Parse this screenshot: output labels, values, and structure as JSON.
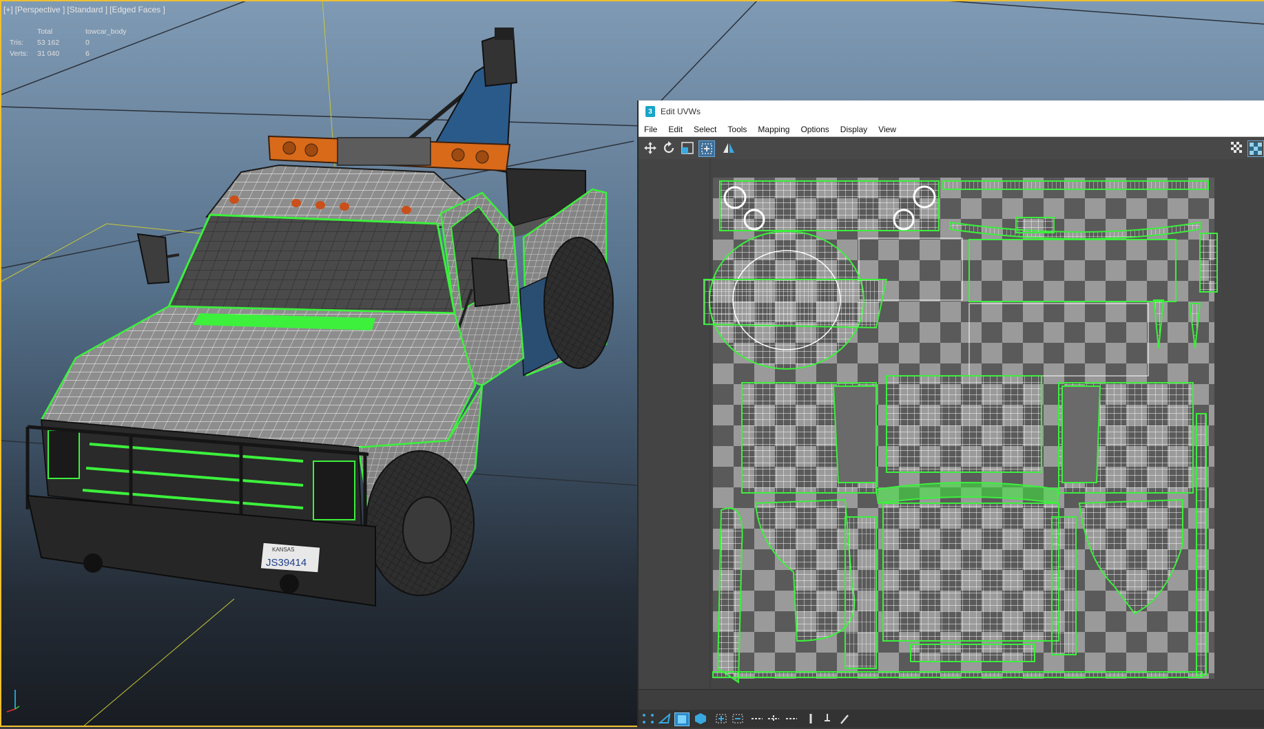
{
  "viewport": {
    "label_parts": [
      "[+]",
      "[Perspective ]",
      "[Standard ]",
      "[Edged Faces ]"
    ],
    "stats": {
      "header_total": "Total",
      "header_object": "towcar_body",
      "rows": [
        {
          "label": "Tris:",
          "total": "53 162",
          "object": "0"
        },
        {
          "label": "Verts:",
          "total": "31 040",
          "object": "6"
        }
      ]
    },
    "license_plate": {
      "state": "KANSAS",
      "number": "JS39414"
    }
  },
  "uv_editor": {
    "title": "Edit UVWs",
    "app_icon": "3",
    "menu": [
      "File",
      "Edit",
      "Select",
      "Tools",
      "Mapping",
      "Options",
      "Display",
      "View"
    ],
    "toolbar_icons": [
      "move-icon",
      "rotate-icon",
      "scale-icon",
      "freeform-icon",
      "mirror-icon",
      "checker-toggle-icon",
      "checker-map-icon"
    ],
    "bottom_icons": [
      "vertex-select-icon",
      "edge-select-icon",
      "face-select-icon",
      "element-select-icon",
      "grow-icon",
      "shrink-icon",
      "loop-icon",
      "ring-icon",
      "align-icon",
      "straighten-icon",
      "pin-icon",
      "paint-icon"
    ]
  },
  "colors": {
    "selection_green": "#3cf03c",
    "viewport_border": "#f0c030",
    "light_bar_orange": "#d86a1a",
    "crane_blue": "#2a5a8a",
    "checker_light": "#9a9a9a",
    "checker_dark": "#5a5a5a"
  }
}
